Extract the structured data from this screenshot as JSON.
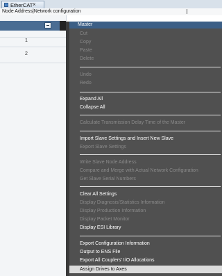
{
  "tab": {
    "label": "EtherCAT",
    "close": "×"
  },
  "header": {
    "column_title": "Node Address|Network configuration"
  },
  "rows": [
    {
      "num": "1"
    },
    {
      "num": "2"
    }
  ],
  "menu": {
    "title": "Master",
    "groups": [
      [
        "Cut",
        "Copy",
        "Paste",
        "Delete"
      ],
      [
        "Undo",
        "Redo"
      ],
      [
        "Expand All",
        "Collapse All"
      ],
      [
        "Calculate Transmission Delay Time of the Master"
      ],
      [
        "Import Slave Settings and Insert New Slave",
        "Export Slave Settings"
      ],
      [
        "Write Slave Node Address",
        "Compare and Merge with Actual Network Configuration",
        "Get Slave Serial Numbers"
      ],
      [
        "Clear All Settings",
        "Display Diagnosis/Statistics Information",
        "Display Production Information",
        "Display Packet Monitor",
        "Display ESI Library"
      ],
      [
        "Export Configuration Information",
        "Output to ENS File",
        "Export All Couplers' I/O Allocations",
        "Assign Drives to Axes"
      ]
    ],
    "disabled": [
      "Cut",
      "Copy",
      "Paste",
      "Delete",
      "Undo",
      "Redo",
      "Calculate Transmission Delay Time of the Master",
      "Export Slave Settings",
      "Write Slave Node Address",
      "Compare and Merge with Actual Network Configuration",
      "Get Slave Serial Numbers",
      "Display Diagnosis/Statistics Information",
      "Display Production Information",
      "Display Packet Monitor"
    ],
    "highlighted": "Assign Drives to Axes"
  }
}
